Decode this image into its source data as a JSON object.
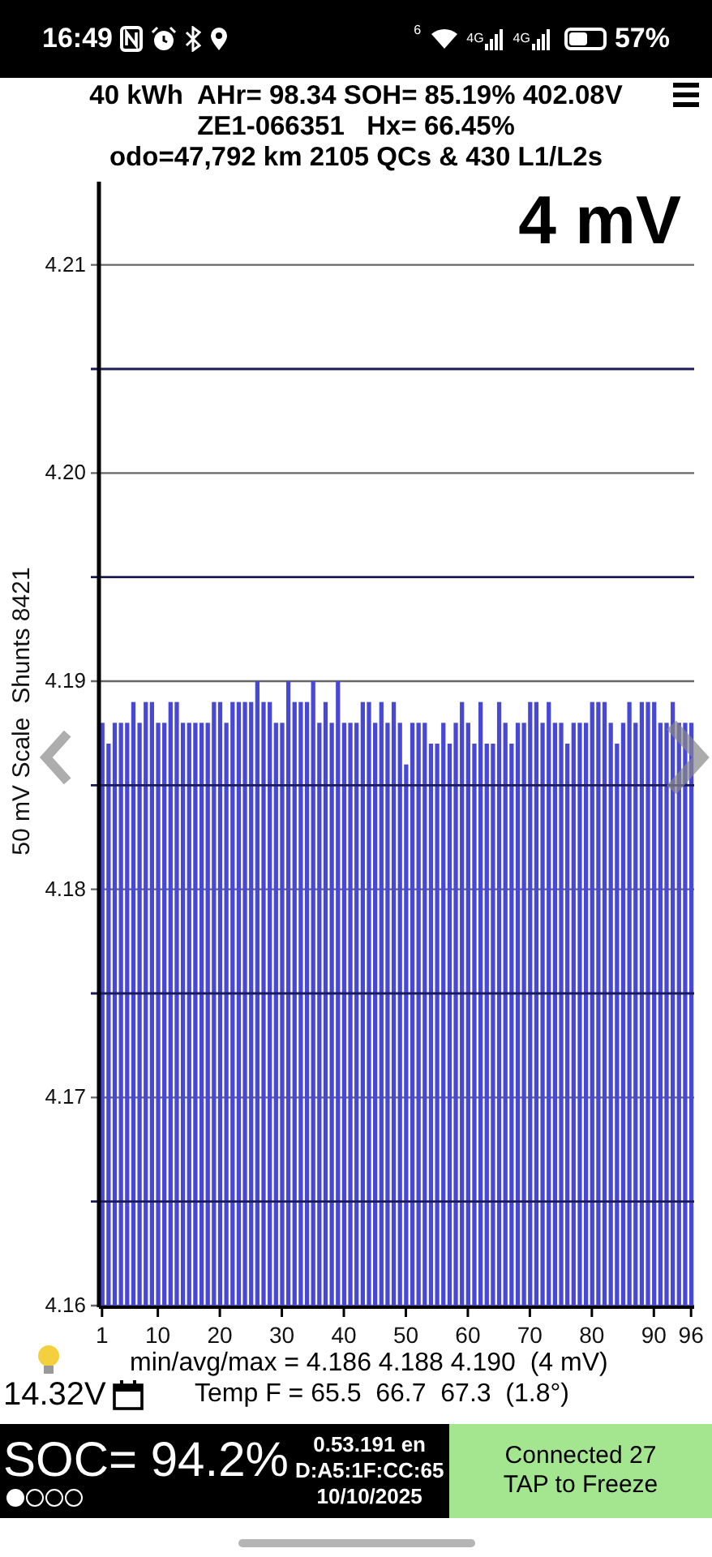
{
  "status_bar": {
    "time": "16:49",
    "wifi_badge": "6",
    "signal_labels": [
      "4G",
      "4G"
    ],
    "battery": "57%"
  },
  "header": {
    "lines": [
      "40 kWh  AHr= 98.34 SOH= 85.19% 402.08V",
      "ZE1-066351   Hx= 66.45%",
      "odo=47,792 km 2105 QCs & 430 L1/L2s"
    ]
  },
  "chart": {
    "chart_data": {
      "type": "bar",
      "title": "4 mV",
      "ylabel": "50 mV Scale  Shunts 8421",
      "ylim": [
        4.16,
        4.214
      ],
      "yticks": [
        {
          "value": 4.16,
          "label": "4.16"
        },
        {
          "value": 4.17,
          "label": "4.17"
        },
        {
          "value": 4.18,
          "label": "4.18"
        },
        {
          "value": 4.19,
          "label": "4.19"
        },
        {
          "value": 4.2,
          "label": "4.20"
        },
        {
          "value": 4.21,
          "label": "4.21"
        }
      ],
      "x": [
        1,
        2,
        3,
        4,
        5,
        6,
        7,
        8,
        9,
        10,
        11,
        12,
        13,
        14,
        15,
        16,
        17,
        18,
        19,
        20,
        21,
        22,
        23,
        24,
        25,
        26,
        27,
        28,
        29,
        30,
        31,
        32,
        33,
        34,
        35,
        36,
        37,
        38,
        39,
        40,
        41,
        42,
        43,
        44,
        45,
        46,
        47,
        48,
        49,
        50,
        51,
        52,
        53,
        54,
        55,
        56,
        57,
        58,
        59,
        60,
        61,
        62,
        63,
        64,
        65,
        66,
        67,
        68,
        69,
        70,
        71,
        72,
        73,
        74,
        75,
        76,
        77,
        78,
        79,
        80,
        81,
        82,
        83,
        84,
        85,
        86,
        87,
        88,
        89,
        90,
        91,
        92,
        93,
        94,
        95,
        96
      ],
      "xlim": [
        0.5,
        96.5
      ],
      "xticks": [
        1,
        10,
        20,
        30,
        40,
        50,
        60,
        70,
        80,
        90,
        96
      ],
      "grid": true,
      "ref_lines": [
        {
          "axis": "y",
          "value": 4.165
        },
        {
          "axis": "y",
          "value": 4.175
        },
        {
          "axis": "y",
          "value": 4.185
        },
        {
          "axis": "y",
          "value": 4.195
        },
        {
          "axis": "y",
          "value": 4.205
        }
      ],
      "series": [
        {
          "color": "#4848d8",
          "values": [
            4.188,
            4.187,
            4.188,
            4.188,
            4.188,
            4.189,
            4.188,
            4.189,
            4.189,
            4.188,
            4.188,
            4.189,
            4.189,
            4.188,
            4.188,
            4.188,
            4.188,
            4.188,
            4.189,
            4.189,
            4.188,
            4.189,
            4.189,
            4.189,
            4.189,
            4.19,
            4.189,
            4.189,
            4.188,
            4.188,
            4.19,
            4.189,
            4.189,
            4.189,
            4.19,
            4.188,
            4.189,
            4.188,
            4.19,
            4.188,
            4.188,
            4.188,
            4.189,
            4.189,
            4.188,
            4.189,
            4.188,
            4.189,
            4.188,
            4.186,
            4.188,
            4.188,
            4.188,
            4.187,
            4.187,
            4.188,
            4.187,
            4.188,
            4.189,
            4.188,
            4.187,
            4.189,
            4.187,
            4.187,
            4.189,
            4.188,
            4.187,
            4.188,
            4.188,
            4.189,
            4.189,
            4.188,
            4.189,
            4.188,
            4.188,
            4.187,
            4.188,
            4.188,
            4.188,
            4.189,
            4.189,
            4.189,
            4.188,
            4.187,
            4.188,
            4.189,
            4.188,
            4.189,
            4.189,
            4.189,
            4.188,
            4.188,
            4.189,
            4.188,
            4.188,
            4.188
          ]
        }
      ]
    }
  },
  "stats": {
    "aux_voltage": "14.32V",
    "min_avg_max": "min/avg/max = 4.186 4.188 4.190  (4 mV)",
    "temp": "Temp F = 65.5  66.7  67.3  (1.8°)"
  },
  "footer": {
    "soc": "SOC= 94.2%",
    "pages": [
      {
        "selected": true
      },
      {
        "selected": false
      },
      {
        "selected": false
      },
      {
        "selected": false
      }
    ],
    "info_lines": [
      "0.53.191 en",
      "D:A5:1F:CC:65",
      "10/10/2025"
    ],
    "connection": [
      "Connected 27",
      "TAP to Freeze"
    ]
  }
}
